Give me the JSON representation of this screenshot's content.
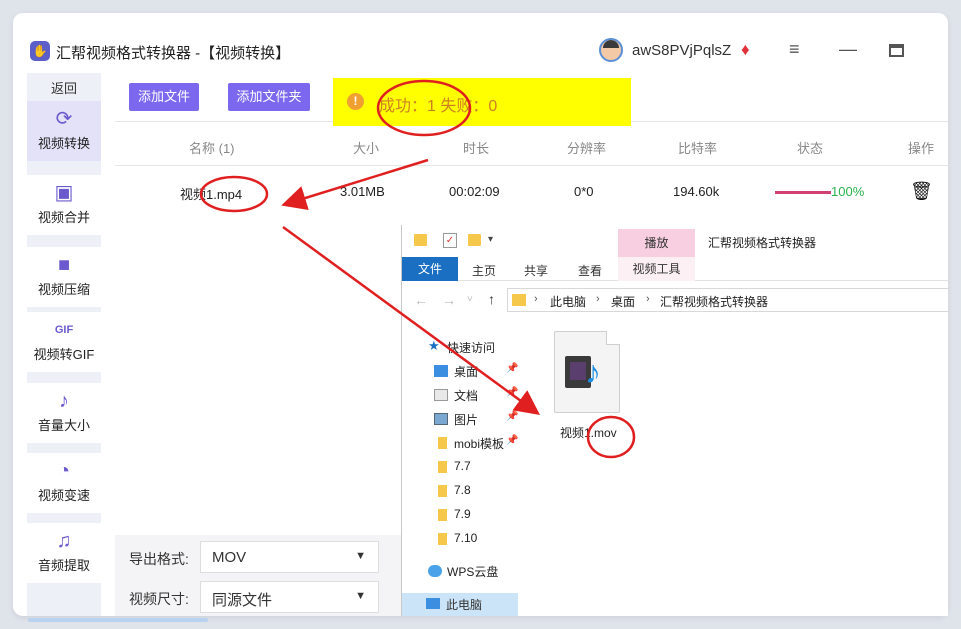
{
  "app": {
    "title": "汇帮视频格式转换器 -【视频转换】",
    "username": "awS8PVjPqlsZ"
  },
  "sidebar": {
    "back_label": "返回",
    "items": [
      {
        "label": "视频转换",
        "icon": "video-convert-icon",
        "active": true
      },
      {
        "label": "视频合并",
        "icon": "video-merge-icon"
      },
      {
        "label": "视频压缩",
        "icon": "video-compress-icon"
      },
      {
        "label": "视频转GIF",
        "icon": "gif-icon"
      },
      {
        "label": "音量大小",
        "icon": "music-note-icon"
      },
      {
        "label": "视频变速",
        "icon": "speedometer-icon"
      },
      {
        "label": "音频提取",
        "icon": "audio-extract-icon"
      }
    ]
  },
  "toolbar": {
    "add_file_label": "添加文件",
    "add_folder_label": "添加文件夹"
  },
  "toast": {
    "text": "成功：1  失败：0"
  },
  "table": {
    "columns": [
      "名称 (1)",
      "大小",
      "时长",
      "分辨率",
      "比特率",
      "状态",
      "操作"
    ],
    "rows": [
      {
        "name": "视频1.mp4",
        "size": "3.01MB",
        "duration": "00:02:09",
        "resolution": "0*0",
        "bitrate": "194.60k",
        "progress": "100%"
      }
    ]
  },
  "options": {
    "format_label": "导出格式:",
    "format_value": "MOV",
    "size_label": "视频尺寸:",
    "size_value": "同源文件"
  },
  "explorer": {
    "play_tab": "播放",
    "title": "汇帮视频格式转换器",
    "ribbon": {
      "file": "文件",
      "home": "主页",
      "share": "共享",
      "view": "查看",
      "video_tools": "视频工具"
    },
    "breadcrumb": [
      "此电脑",
      "桌面",
      "汇帮视频格式转换器"
    ],
    "quick_access": "快速访问",
    "nav_items": [
      {
        "label": "桌面",
        "pinned": true
      },
      {
        "label": "文档",
        "pinned": true
      },
      {
        "label": "图片",
        "pinned": true
      },
      {
        "label": "mobi模板",
        "pinned": true
      },
      {
        "label": "7.7"
      },
      {
        "label": "7.8"
      },
      {
        "label": "7.9"
      },
      {
        "label": "7.10"
      }
    ],
    "wps_cloud": "WPS云盘",
    "this_pc": "此电脑",
    "file_name": "视频1.mov"
  },
  "colors": {
    "accent": "#7b68ee",
    "toast_bg": "#ffff00",
    "success_green": "#2bb24c",
    "annotation_red": "#e02020",
    "explorer_blue": "#1a6fc2"
  }
}
